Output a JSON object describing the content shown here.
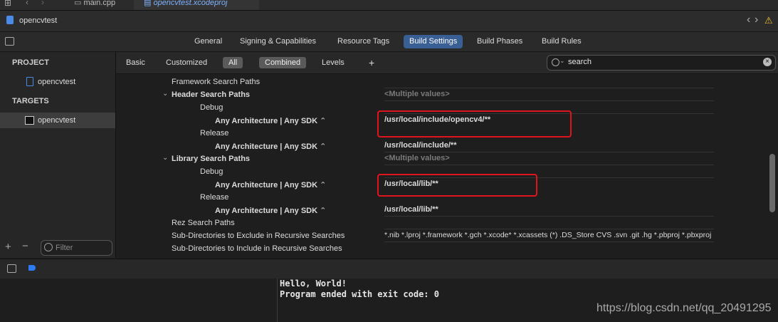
{
  "top_tabs": [
    {
      "label": "main.cpp",
      "active": false
    },
    {
      "label": "opencvtest.xcodeproj",
      "active": true
    }
  ],
  "filebar": {
    "project_name": "opencvtest"
  },
  "editor_tabs": [
    "General",
    "Signing & Capabilities",
    "Resource Tags",
    "Build Settings",
    "Build Phases",
    "Build Rules"
  ],
  "selected_editor_tab": "Build Settings",
  "sidebar": {
    "project_header": "PROJECT",
    "project_item": "opencvtest",
    "targets_header": "TARGETS",
    "target_item": "opencvtest",
    "filter_placeholder": "Filter"
  },
  "filter_tabs": {
    "basic": "Basic",
    "customized": "Customized",
    "all": "All",
    "combined": "Combined",
    "levels": "Levels",
    "add": "+"
  },
  "search": {
    "value": "search"
  },
  "settings": {
    "framework_search_paths": "Framework Search Paths",
    "header_search_paths": "Header Search Paths",
    "header_value": "<Multiple values>",
    "debug": "Debug",
    "release": "Release",
    "arch": "Any Architecture | Any SDK",
    "header_debug_value": "/usr/local/include/opencv4/**",
    "header_release_value": "/usr/local/include/**",
    "library_search_paths": "Library Search Paths",
    "library_value": "<Multiple values>",
    "library_debug_value": "/usr/local/lib/**",
    "library_release_value": "/usr/local/lib/**",
    "rez_search_paths": "Rez Search Paths",
    "subdirs_exclude": "Sub-Directories to Exclude in Recursive Searches",
    "subdirs_exclude_value": "*.nib *.lproj *.framework *.gch *.xcode* *.xcassets (*) .DS_Store CVS .svn .git .hg *.pbproj *.pbxproj",
    "subdirs_include": "Sub-Directories to Include in Recursive Searches"
  },
  "console": {
    "line1": "Hello, World!",
    "line2": "Program ended with exit code: 0"
  },
  "watermark": "https://blog.csdn.net/qq_20491295",
  "colors": {
    "accent": "#3a5f94",
    "highlight_box": "#e0141e"
  }
}
